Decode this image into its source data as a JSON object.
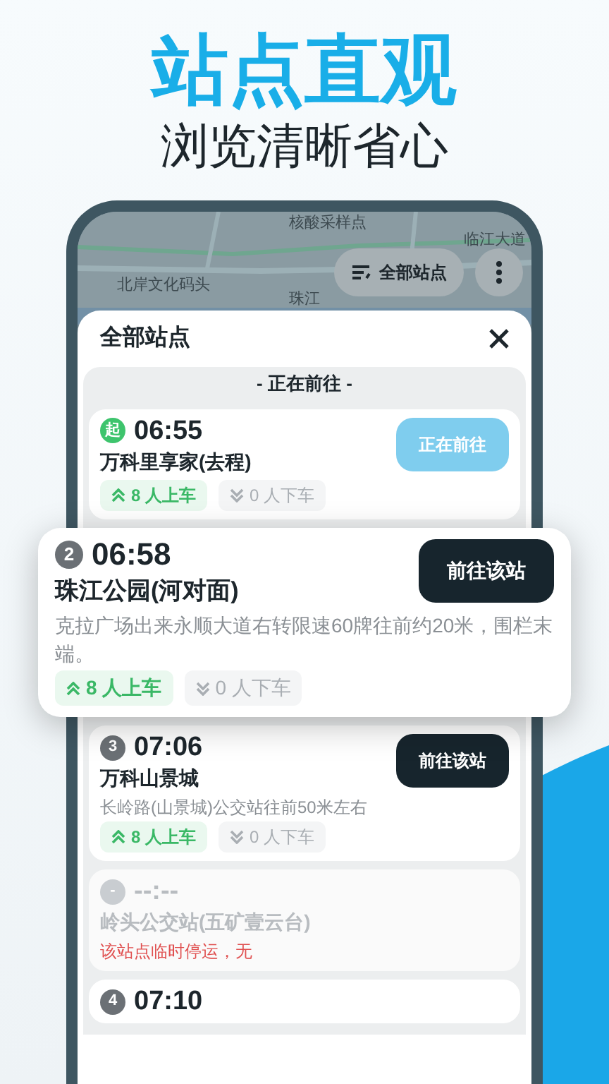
{
  "hero": {
    "title": "站点直观",
    "subtitle": "浏览清晰省心"
  },
  "map": {
    "labels": [
      "核酸采样点",
      "临江大道",
      "北岸文化码头",
      "珠江"
    ],
    "filter_button": "全部站点"
  },
  "sheet": {
    "title": "全部站点",
    "section_label": "- 正在前往 -",
    "stops": [
      {
        "kind": "current",
        "badge": "起",
        "time": "06:55",
        "name": "万科里享家(去程)",
        "boarding": "8 人上车",
        "alighting": "0 人下车",
        "button": {
          "label": "正在前往",
          "disabled": true
        }
      },
      {
        "kind": "popup",
        "badge": "2",
        "time": "06:58",
        "name": "珠江公园(河对面)",
        "note": "克拉广场出来永顺大道右转限速60牌往前约20米，围栏末端。",
        "boarding": "8 人上车",
        "alighting": "0 人下车",
        "button": {
          "label": "前往该站",
          "disabled": false
        }
      },
      {
        "kind": "normal",
        "badge": "3",
        "time": "07:06",
        "name": "万科山景城",
        "note": "长岭路(山景城)公交站往前50米左右",
        "boarding": "8 人上车",
        "alighting": "0 人下车",
        "button": {
          "label": "前往该站",
          "disabled": false
        }
      },
      {
        "kind": "suspended",
        "badge": "-",
        "time": "--:--",
        "name": "岭头公交站(五矿壹云台)",
        "note": "该站点临时停运，无"
      },
      {
        "kind": "normal",
        "badge": "4",
        "time": "07:10"
      }
    ]
  }
}
